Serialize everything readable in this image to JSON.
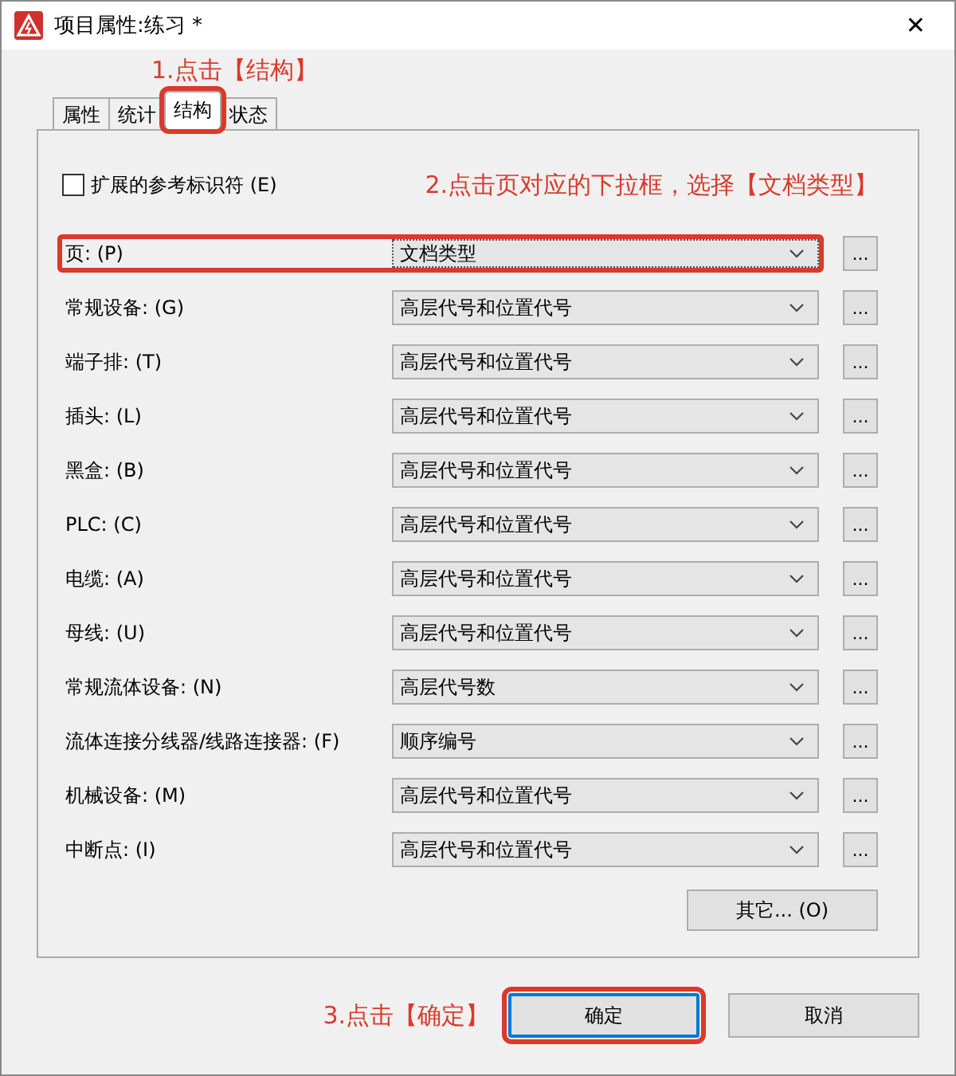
{
  "window": {
    "title": "项目属性:练习 *",
    "close": "✕"
  },
  "annotations": [
    "1.点击【结构】",
    "2.点击页对应的下拉框，选择【文档类型】",
    "3.点击【确定】"
  ],
  "tabs": [
    {
      "label": "属性",
      "selected": false,
      "highlighted": false
    },
    {
      "label": "统计",
      "selected": false,
      "highlighted": false
    },
    {
      "label": "结构",
      "selected": true,
      "highlighted": true
    },
    {
      "label": "状态",
      "selected": false,
      "highlighted": false
    }
  ],
  "checkbox": {
    "label": "扩展的参考标识符 (E)",
    "checked": false
  },
  "rows": [
    {
      "label": "页: (P)",
      "value": "文档类型",
      "highlighted": true,
      "button": "..."
    },
    {
      "label": "常规设备: (G)",
      "value": "高层代号和位置代号",
      "highlighted": false,
      "button": "..."
    },
    {
      "label": "端子排: (T)",
      "value": "高层代号和位置代号",
      "highlighted": false,
      "button": "..."
    },
    {
      "label": "插头: (L)",
      "value": "高层代号和位置代号",
      "highlighted": false,
      "button": "..."
    },
    {
      "label": "黑盒: (B)",
      "value": "高层代号和位置代号",
      "highlighted": false,
      "button": "..."
    },
    {
      "label": "PLC: (C)",
      "value": "高层代号和位置代号",
      "highlighted": false,
      "button": "..."
    },
    {
      "label": "电缆: (A)",
      "value": "高层代号和位置代号",
      "highlighted": false,
      "button": "..."
    },
    {
      "label": "母线: (U)",
      "value": "高层代号和位置代号",
      "highlighted": false,
      "button": "..."
    },
    {
      "label": "常规流体设备: (N)",
      "value": "高层代号数",
      "highlighted": false,
      "button": "..."
    },
    {
      "label": "流体连接分线器/线路连接器: (F)",
      "value": "顺序编号",
      "highlighted": false,
      "button": "..."
    },
    {
      "label": "机械设备: (M)",
      "value": "高层代号和位置代号",
      "highlighted": false,
      "button": "..."
    },
    {
      "label": "中断点: (I)",
      "value": "高层代号和位置代号",
      "highlighted": false,
      "button": "..."
    }
  ],
  "other_button": "其它... (O)",
  "footer": [
    {
      "label": "确定",
      "highlighted": true,
      "default": true
    },
    {
      "label": "取消",
      "highlighted": false,
      "default": false
    }
  ]
}
